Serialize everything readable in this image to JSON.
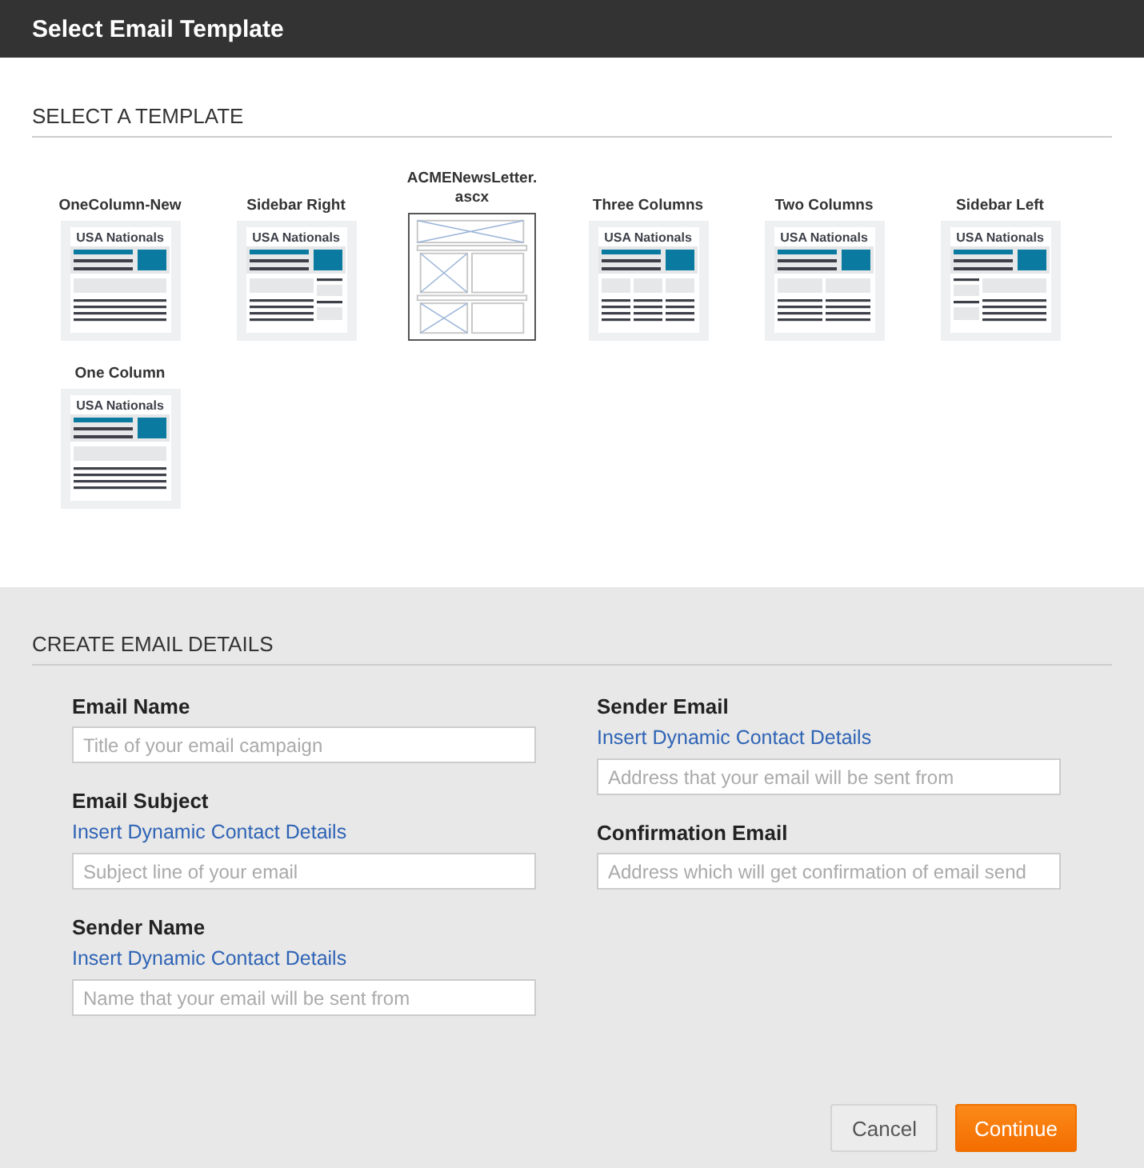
{
  "window": {
    "title": "Select Email Template"
  },
  "template_section": {
    "title": "SELECT A TEMPLATE",
    "templates": [
      {
        "label": "OneColumn-New",
        "kind": "one-column",
        "heading": "USA Nationals"
      },
      {
        "label": "Sidebar Right",
        "kind": "sidebar-right",
        "heading": "USA Nationals"
      },
      {
        "label": "ACMENewsLetter.ascx",
        "kind": "placeholder"
      },
      {
        "label": "Three Columns",
        "kind": "three-columns",
        "heading": "USA Nationals"
      },
      {
        "label": "Two Columns",
        "kind": "two-columns",
        "heading": "USA Nationals"
      },
      {
        "label": "Sidebar Left",
        "kind": "sidebar-left",
        "heading": "USA Nationals"
      },
      {
        "label": "One Column",
        "kind": "one-column",
        "heading": "USA Nationals"
      }
    ]
  },
  "details_section": {
    "title": "CREATE EMAIL DETAILS",
    "columns": [
      [
        {
          "label": "Email Name",
          "placeholder": "Title of your email campaign"
        },
        {
          "label": "Email Subject",
          "link": "Insert Dynamic Contact Details",
          "placeholder": "Subject line of your email"
        },
        {
          "label": "Sender Name",
          "link": "Insert Dynamic Contact Details",
          "placeholder": "Name that your email will be sent from"
        }
      ],
      [
        {
          "label": "Sender Email",
          "link": "Insert Dynamic Contact Details",
          "placeholder": "Address that your email will be sent from"
        },
        {
          "label": "Confirmation Email",
          "placeholder": "Address which will get confirmation of email send"
        }
      ]
    ]
  },
  "buttons": [
    {
      "label": "Cancel",
      "kind": "secondary"
    },
    {
      "label": "Continue",
      "kind": "primary"
    }
  ]
}
